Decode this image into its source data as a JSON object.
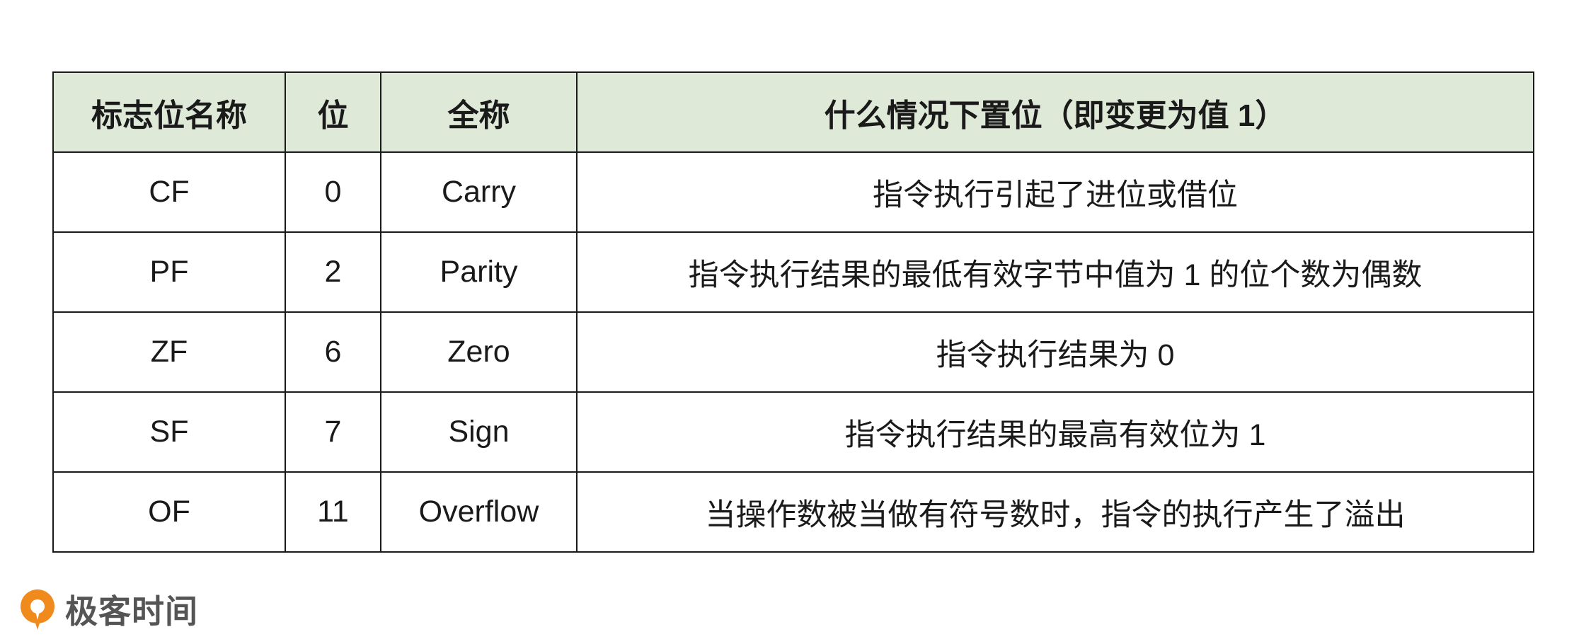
{
  "table": {
    "headers": [
      "标志位名称",
      "位",
      "全称",
      "什么情况下置位（即变更为值 1）"
    ],
    "rows": [
      [
        "CF",
        "0",
        "Carry",
        "指令执行引起了进位或借位"
      ],
      [
        "PF",
        "2",
        "Parity",
        "指令执行结果的最低有效字节中值为 1 的位个数为偶数"
      ],
      [
        "ZF",
        "6",
        "Zero",
        "指令执行结果为 0"
      ],
      [
        "SF",
        "7",
        "Sign",
        "指令执行结果的最高有效位为 1"
      ],
      [
        "OF",
        "11",
        "Overflow",
        "当操作数被当做有符号数时，指令的执行产生了溢出"
      ]
    ]
  },
  "logo": {
    "text": "极客时间",
    "icon": "geektime-logo-icon",
    "color": "#f08a1c"
  },
  "colors": {
    "header_background": "#dfe9d8",
    "border": "#1a1a1a"
  }
}
